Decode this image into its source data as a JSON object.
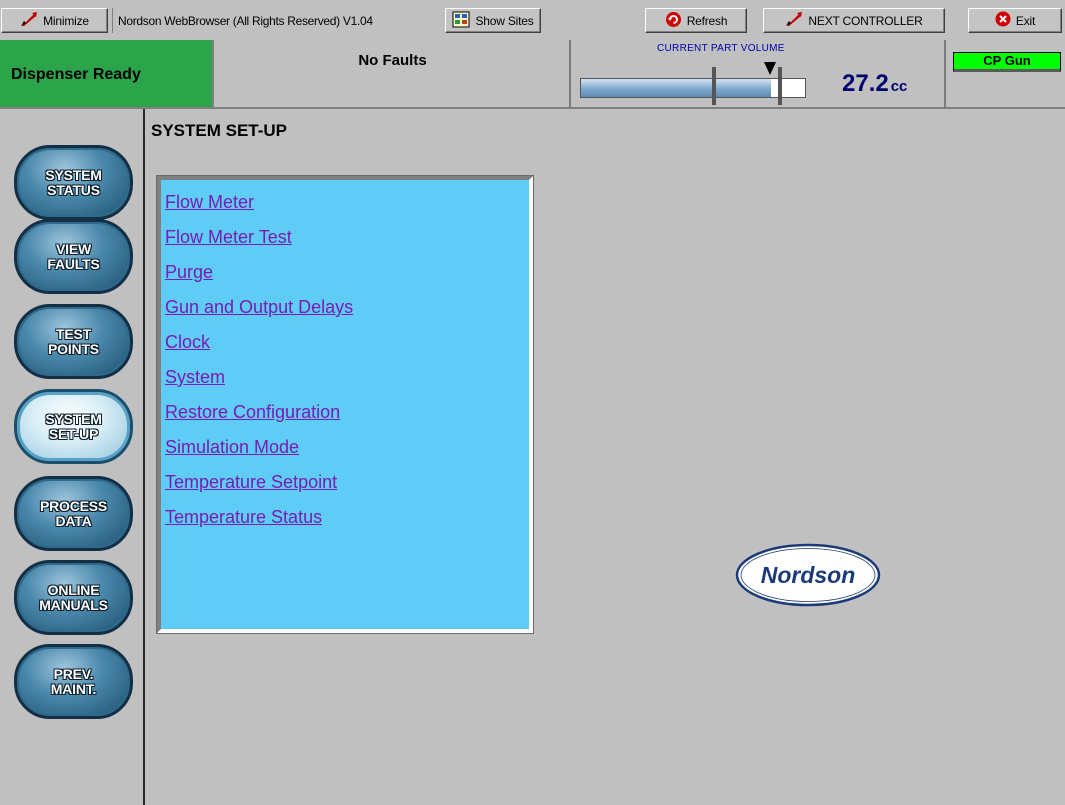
{
  "toolbar": {
    "minimize_label": "Minimize",
    "title": "Nordson WebBrowser (All Rights Reserved) V1.04",
    "show_sites_label": "Show Sites",
    "refresh_label": "Refresh",
    "next_controller_label": "NEXT CONTROLLER",
    "exit_label": "Exit"
  },
  "status": {
    "dispenser_state": "Dispenser Ready",
    "faults": "No Faults",
    "volume_label": "CURRENT PART VOLUME",
    "volume_value": "27.2",
    "volume_unit": "cc",
    "volume_fill_fraction": 0.85,
    "gun": "CP Gun"
  },
  "colors": {
    "ready_green": "#2ca44a",
    "gun_badge": "#00ff00",
    "menu_panel": "#5fccf5",
    "link": "#7a1bb5",
    "nav_button": "#4a88ab"
  },
  "nav": {
    "items": [
      {
        "line1": "SYSTEM",
        "line2": "STATUS"
      },
      {
        "line1": "VIEW",
        "line2": "FAULTS"
      },
      {
        "line1": "TEST",
        "line2": "POINTS"
      },
      {
        "line1": "SYSTEM",
        "line2": "SET-UP"
      },
      {
        "line1": "PROCESS",
        "line2": "DATA"
      },
      {
        "line1": "ONLINE",
        "line2": "MANUALS"
      },
      {
        "line1": "PREV.",
        "line2": "MAINT."
      }
    ],
    "active_index": 3
  },
  "main": {
    "title": "SYSTEM SET-UP",
    "links": [
      "Flow Meter",
      "Flow Meter Test",
      "Purge",
      "Gun and Output Delays",
      "Clock",
      "System",
      "Restore Configuration",
      "Simulation Mode",
      "Temperature Setpoint",
      "Temperature Status"
    ]
  },
  "logo": {
    "text": "Nordson"
  },
  "icons": {
    "minimize": "minimize-icon",
    "show_sites": "sites-icon",
    "refresh": "refresh-icon",
    "next_controller": "next-controller-icon",
    "exit": "exit-icon",
    "volume_pointer": "pointer-icon"
  }
}
